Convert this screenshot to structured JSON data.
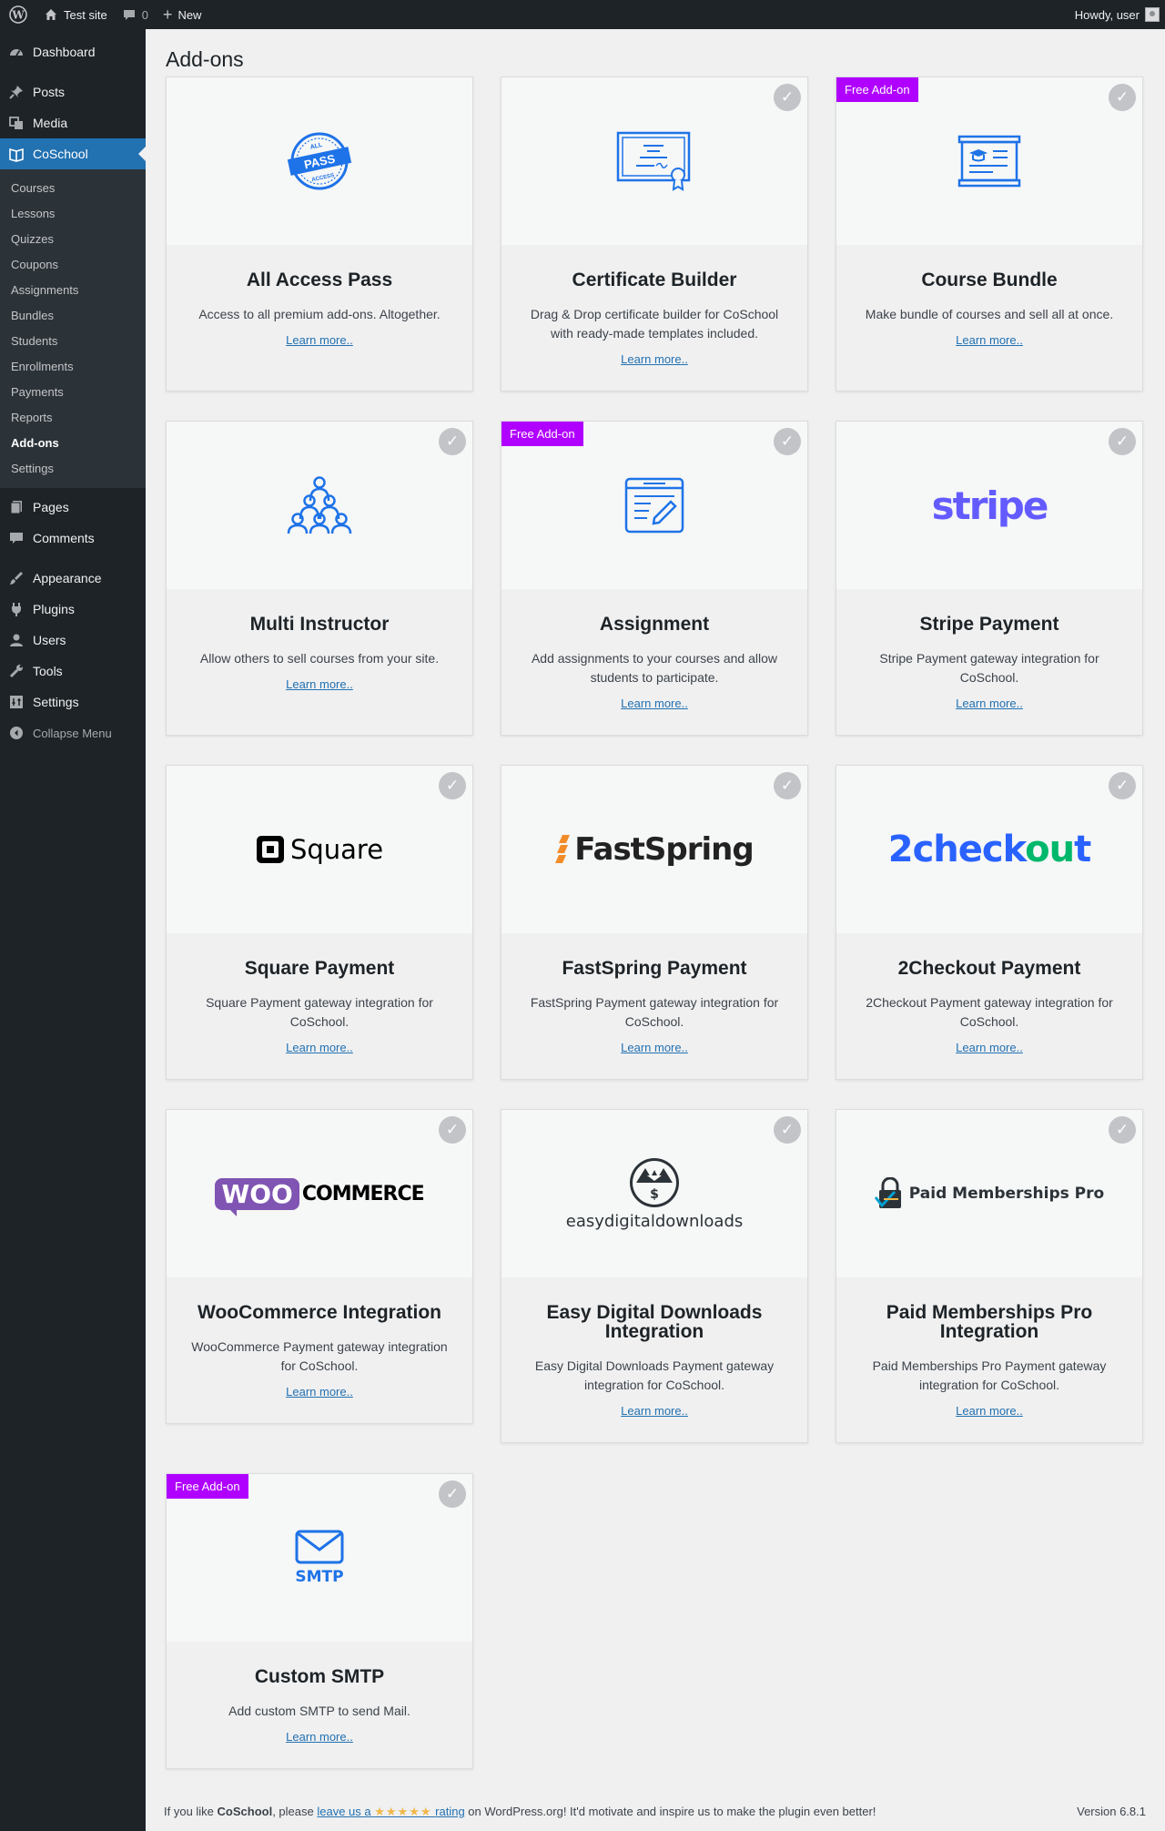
{
  "admin_bar": {
    "site_name": "Test site",
    "comments_count": "0",
    "new_label": "New",
    "howdy": "Howdy, user"
  },
  "sidebar": {
    "items_top": [
      {
        "label": "Dashboard",
        "icon": "dashboard-icon"
      },
      {
        "label": "Posts",
        "icon": "pin-icon"
      },
      {
        "label": "Media",
        "icon": "media-icon"
      },
      {
        "label": "CoSchool",
        "icon": "book-icon"
      }
    ],
    "submenu": [
      "Courses",
      "Lessons",
      "Quizzes",
      "Coupons",
      "Assignments",
      "Bundles",
      "Students",
      "Enrollments",
      "Payments",
      "Reports",
      "Add-ons",
      "Settings"
    ],
    "submenu_active": "Add-ons",
    "items_mid": [
      {
        "label": "Pages",
        "icon": "page-icon"
      },
      {
        "label": "Comments",
        "icon": "comment-icon"
      }
    ],
    "items_bottom": [
      {
        "label": "Appearance",
        "icon": "brush-icon"
      },
      {
        "label": "Plugins",
        "icon": "plug-icon"
      },
      {
        "label": "Users",
        "icon": "user-icon"
      },
      {
        "label": "Tools",
        "icon": "wrench-icon"
      },
      {
        "label": "Settings",
        "icon": "settings-icon"
      }
    ],
    "collapse_label": "Collapse Menu"
  },
  "page_title": "Add-ons",
  "badge_label": "Free Add-on",
  "learn_more": "Learn more..",
  "logos": {
    "pass_all": "ALL",
    "pass_main": "PASS",
    "pass_access": "ACCESS",
    "stripe": "stripe",
    "square": "Square",
    "fastspring": "FastSpring",
    "twocheckout_a": "2check",
    "twocheckout_b": "ou",
    "twocheckout_c": "t",
    "woo": "WOO",
    "commerce": "COMMERCE",
    "edd": "easydigitaldownloads",
    "pmp": "Paid Memberships Pro",
    "smtp": "SMTP"
  },
  "addons": [
    {
      "title": "All Access Pass",
      "desc": "Access to all premium add-ons. Altogether.",
      "free": false,
      "installed": false,
      "logo": "pass-logo"
    },
    {
      "title": "Certificate Builder",
      "desc": "Drag & Drop certificate builder for CoSchool with ready-made templates included.",
      "free": false,
      "installed": true,
      "logo": "certificate-icon"
    },
    {
      "title": "Course Bundle",
      "desc": "Make bundle of courses and sell all at once.",
      "free": true,
      "installed": true,
      "logo": "bundle-icon"
    },
    {
      "title": "Multi Instructor",
      "desc": "Allow others to sell courses from your site.",
      "free": false,
      "installed": true,
      "logo": "instructors-icon"
    },
    {
      "title": "Assignment",
      "desc": "Add assignments to your courses and allow students to participate.",
      "free": true,
      "installed": true,
      "logo": "assignment-icon"
    },
    {
      "title": "Stripe Payment",
      "desc": "Stripe Payment gateway integration for CoSchool.",
      "free": false,
      "installed": true,
      "logo": "stripe-logo"
    },
    {
      "title": "Square Payment",
      "desc": "Square Payment gateway integration for CoSchool.",
      "free": false,
      "installed": true,
      "logo": "square-logo"
    },
    {
      "title": "FastSpring Payment",
      "desc": "FastSpring Payment gateway integration for CoSchool.",
      "free": false,
      "installed": true,
      "logo": "fastspring-logo"
    },
    {
      "title": "2Checkout Payment",
      "desc": "2Checkout Payment gateway integration for CoSchool.",
      "free": false,
      "installed": true,
      "logo": "2checkout-logo"
    },
    {
      "title": "WooCommerce Integration",
      "desc": "WooCommerce Payment gateway integration for CoSchool.",
      "free": false,
      "installed": true,
      "logo": "woocommerce-logo"
    },
    {
      "title": "Easy Digital Downloads Integration",
      "desc": "Easy Digital Downloads Payment gateway integration for CoSchool.",
      "free": false,
      "installed": true,
      "logo": "edd-logo"
    },
    {
      "title": "Paid Memberships Pro Integration",
      "desc": "Paid Memberships Pro Payment gateway integration for CoSchool.",
      "free": false,
      "installed": true,
      "logo": "pmp-logo"
    },
    {
      "title": "Custom SMTP",
      "desc": "Add custom SMTP to send Mail.",
      "free": true,
      "installed": true,
      "logo": "smtp-icon"
    }
  ],
  "footer": {
    "text1": "If you like ",
    "brand": "CoSchool",
    "text2": ", please ",
    "link_text": "leave us a",
    "stars": "★★★★★",
    "link_text2": "rating",
    "text3": " on WordPress.org! It'd motivate and inspire us to make the plugin even better!",
    "version": "Version 6.8.1"
  },
  "colors": {
    "accent": "#2271b1",
    "badge": "#b000ff",
    "icon_blue": "#1e73e8",
    "stripe": "#635bff",
    "woo": "#7f54b3"
  }
}
